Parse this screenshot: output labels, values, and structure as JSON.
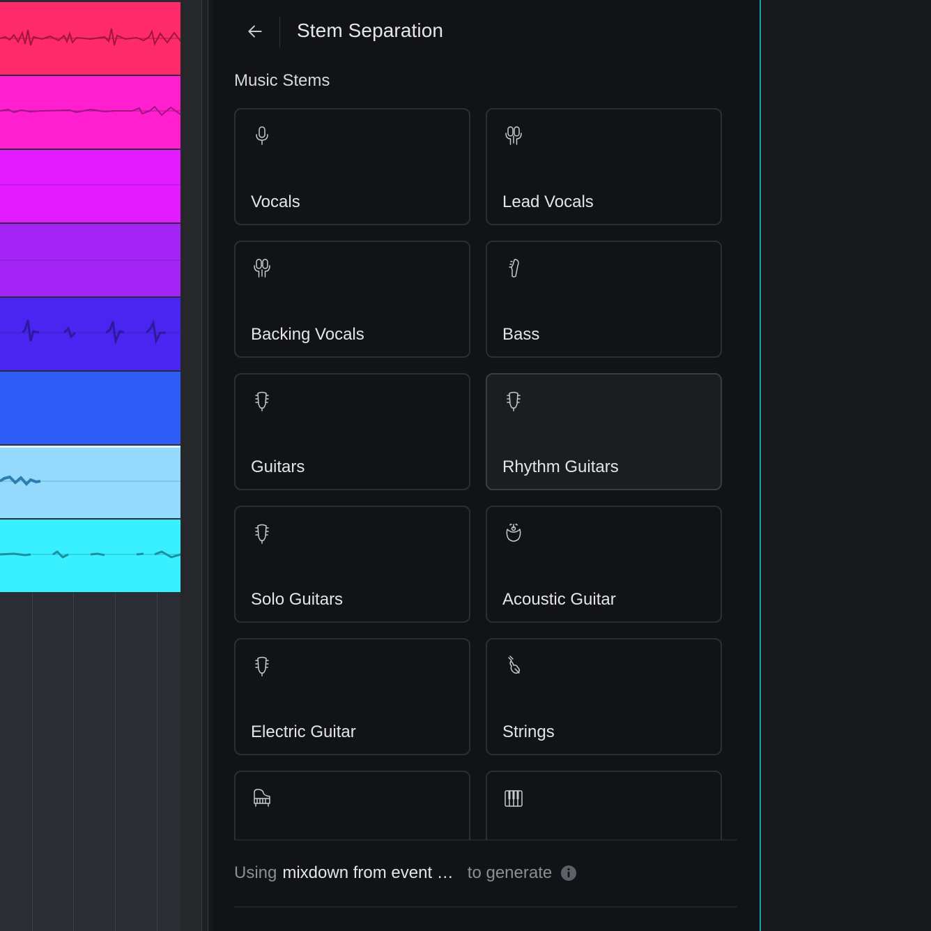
{
  "header": {
    "back_icon": "arrow-left-icon",
    "title": "Stem Separation"
  },
  "section_label": "Music Stems",
  "stems": [
    {
      "label": "Vocals",
      "icon": "microphone-icon"
    },
    {
      "label": "Lead Vocals",
      "icon": "lead-microphone-icon"
    },
    {
      "label": "Backing Vocals",
      "icon": "backing-microphones-icon"
    },
    {
      "label": "Bass",
      "icon": "bass-guitar-icon"
    },
    {
      "label": "Guitars",
      "icon": "guitar-headstock-icon"
    },
    {
      "label": "Rhythm Guitars",
      "icon": "guitar-headstock-icon"
    },
    {
      "label": "Solo Guitars",
      "icon": "guitar-headstock-icon"
    },
    {
      "label": "Acoustic Guitar",
      "icon": "acoustic-guitar-icon"
    },
    {
      "label": "Electric Guitar",
      "icon": "guitar-headstock-icon"
    },
    {
      "label": "Strings",
      "icon": "violin-icon"
    },
    {
      "label": "",
      "icon": "grand-piano-icon"
    },
    {
      "label": "",
      "icon": "keyboard-icon"
    }
  ],
  "footer": {
    "prefix": "Using",
    "source": "mixdown from event …",
    "suffix": "to generate",
    "info_icon": "info-icon"
  },
  "tracks": [
    {
      "color": "#ff2a6a",
      "icon": "waveform"
    },
    {
      "color": "#ff1fcf",
      "icon": "waveform"
    },
    {
      "color": "#e31cff",
      "icon": "waveform"
    },
    {
      "color": "#a324f5",
      "icon": "waveform"
    },
    {
      "color": "#4a25f2",
      "icon": "waveform"
    },
    {
      "color": "#2d5cf7",
      "icon": "waveform"
    },
    {
      "color": "#95dafc",
      "icon": "waveform"
    },
    {
      "color": "#38f0ff",
      "icon": "waveform"
    }
  ],
  "colors": {
    "panel_bg": "#121316",
    "card_border": "#2b2e33",
    "accent_edge": "#1aa1b3",
    "text_primary": "#e3e5e8",
    "text_muted": "#8a8e95"
  }
}
